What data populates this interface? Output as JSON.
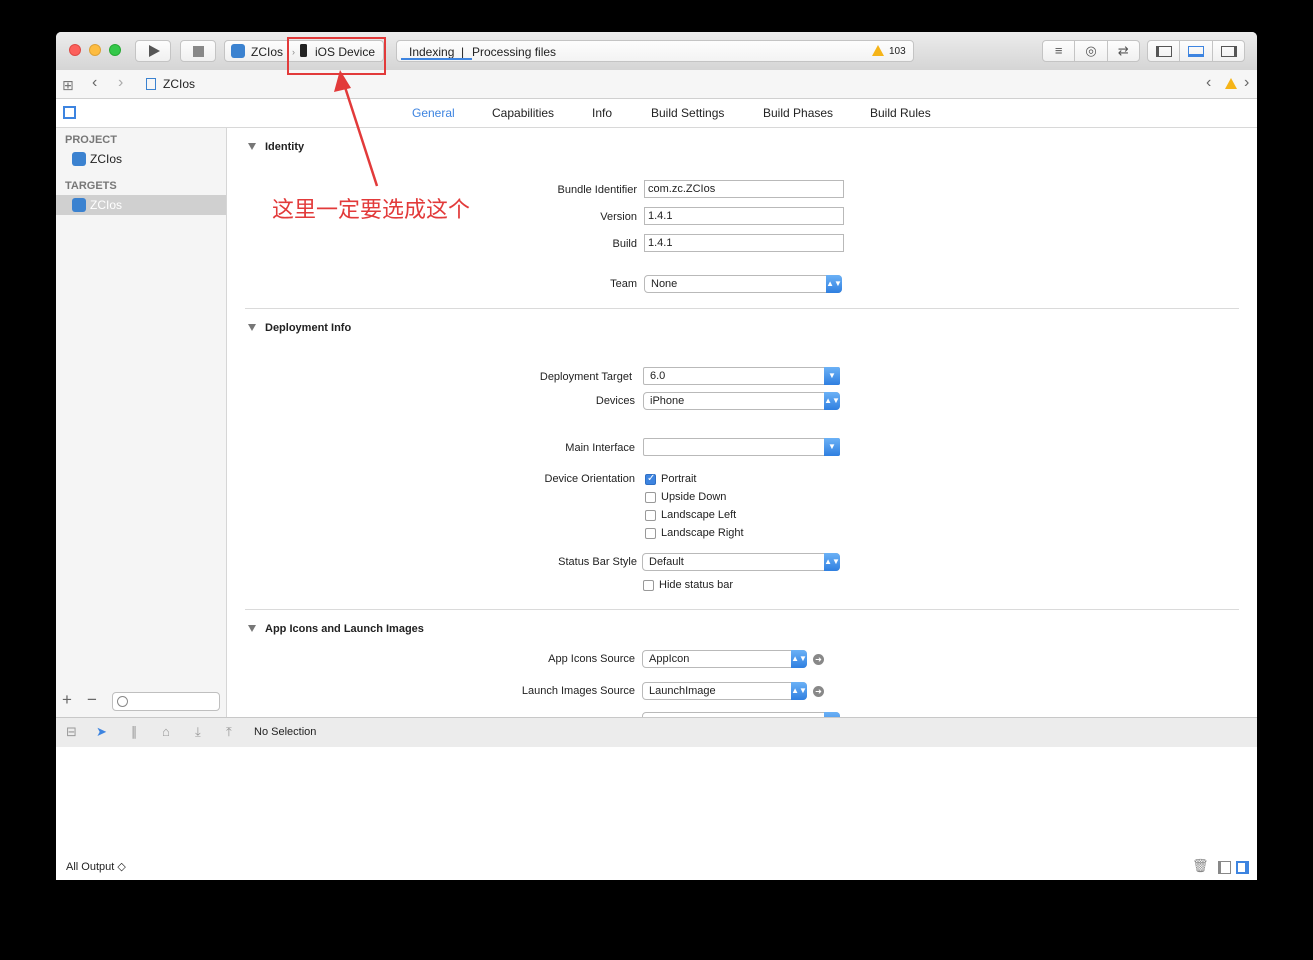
{
  "toolbar": {
    "scheme_name": "ZCIos",
    "device_name": "iOS Device",
    "activity_indexing": "Indexing",
    "activity_separator": "|",
    "activity_processing": "Processing files",
    "warning_count": "103"
  },
  "navbar": {
    "breadcrumb": "ZCIos"
  },
  "tabs": [
    "General",
    "Capabilities",
    "Info",
    "Build Settings",
    "Build Phases",
    "Build Rules"
  ],
  "sidebar": {
    "project_header": "PROJECT",
    "project_item": "ZCIos",
    "targets_header": "TARGETS",
    "target_item": "ZCIos"
  },
  "identity": {
    "title": "Identity",
    "bundle_label": "Bundle Identifier",
    "bundle_value": "com.zc.ZCIos",
    "version_label": "Version",
    "version_value": "1.4.1",
    "build_label": "Build",
    "build_value": "1.4.1",
    "team_label": "Team",
    "team_value": "None"
  },
  "deployment": {
    "title": "Deployment Info",
    "target_label": "Deployment Target",
    "target_value": "6.0",
    "devices_label": "Devices",
    "devices_value": "iPhone",
    "main_interface_label": "Main Interface",
    "main_interface_value": "",
    "orientation_label": "Device Orientation",
    "orientations": [
      {
        "label": "Portrait",
        "checked": true
      },
      {
        "label": "Upside Down",
        "checked": false
      },
      {
        "label": "Landscape Left",
        "checked": false
      },
      {
        "label": "Landscape Right",
        "checked": false
      }
    ],
    "status_bar_label": "Status Bar Style",
    "status_bar_value": "Default",
    "hide_status_bar": "Hide status bar"
  },
  "icons": {
    "title": "App Icons and Launch Images",
    "app_icons_label": "App Icons Source",
    "app_icons_value": "AppIcon",
    "launch_label": "Launch Images Source",
    "launch_value": "LaunchImage"
  },
  "debug": {
    "no_selection": "No Selection",
    "all_output": "All Output ◇"
  },
  "annotation": {
    "text": "这里一定要选成这个"
  },
  "colors": {
    "accent": "#3d84e0",
    "annotation": "#e23a3a",
    "warning": "#f5b418"
  }
}
